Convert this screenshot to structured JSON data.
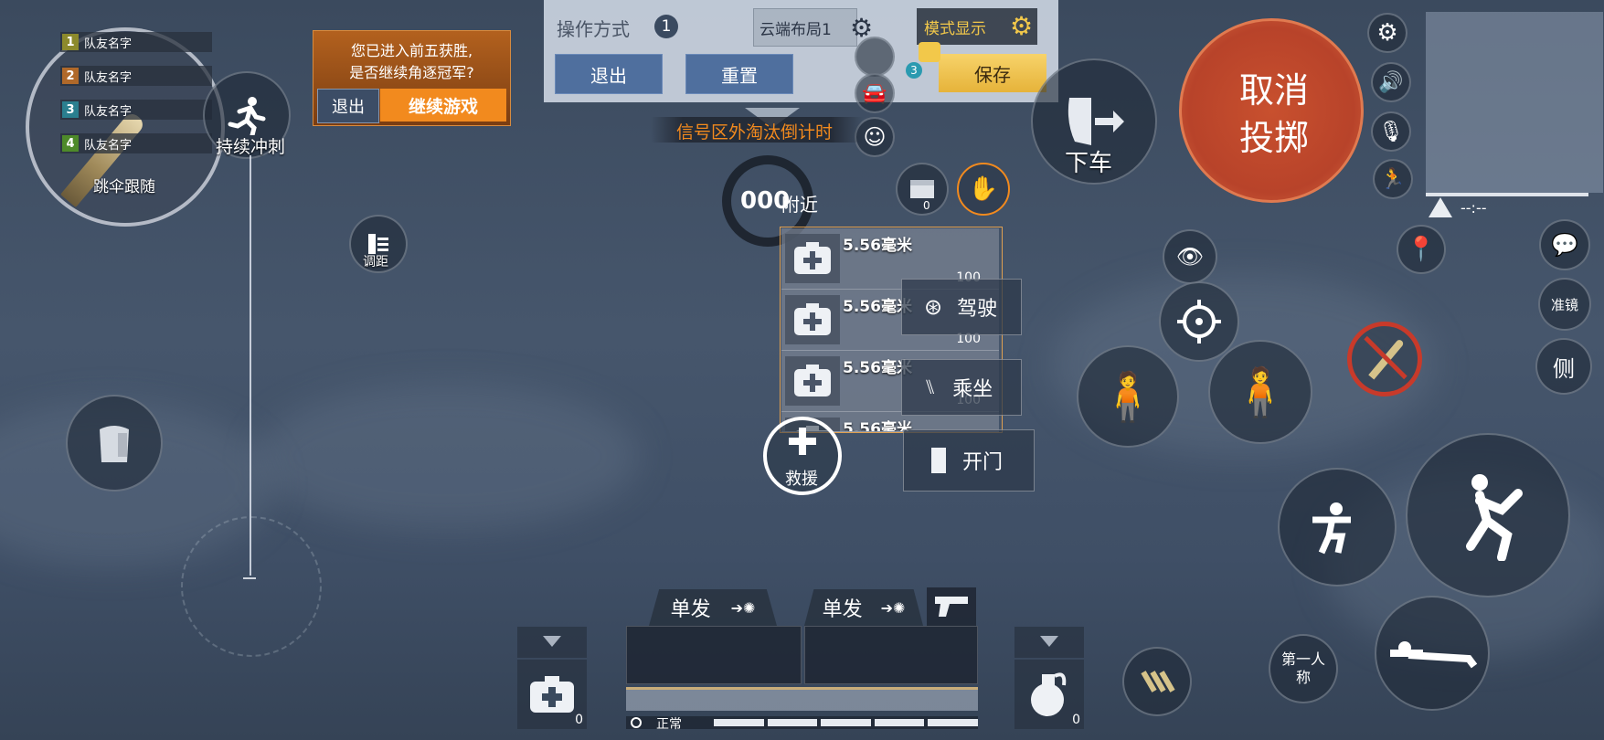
{
  "team": {
    "members": [
      {
        "num": "1",
        "name": "队友名字",
        "color": "#8c8a2c"
      },
      {
        "num": "2",
        "name": "队友名字",
        "color": "#b0692a"
      },
      {
        "num": "3",
        "name": "队友名字",
        "color": "#2a7f8f"
      },
      {
        "num": "4",
        "name": "队友名字",
        "color": "#4e8a2a"
      }
    ],
    "follow_label": "跳伞跟随"
  },
  "sprint_label": "持续冲刺",
  "range_label": "调距",
  "win_prompt": {
    "line1": "您已进入前五获胜,",
    "line2": "是否继续角逐冠军?",
    "exit_label": "退出",
    "continue_label": "继续游戏"
  },
  "layout_panel": {
    "title": "操作方式",
    "info": "1",
    "cloud_label": "云端布局1",
    "mode_label": "模式显示",
    "exit_label": "退出",
    "reset_label": "重置",
    "save_label": "保存",
    "badge": "3"
  },
  "signal_text": "信号区外淘汰倒计时",
  "nearby": {
    "timer": "000",
    "label": "附近"
  },
  "box_count": "0",
  "items": [
    {
      "name": "5.56毫米",
      "qty": "100"
    },
    {
      "name": "5.56毫米",
      "qty": "100"
    },
    {
      "name": "5.56毫米",
      "qty": "100"
    },
    {
      "name": "5.56毫米",
      "qty": ""
    }
  ],
  "actions": {
    "drive": "驾驶",
    "ride": "乘坐",
    "door": "开门",
    "rescue": "救援",
    "exit_vehicle": "下车",
    "cancel_throw": "取消投掷"
  },
  "minimap": {
    "status": "--:--"
  },
  "scope_label": "准镜",
  "side_label": "侧",
  "perspective_label": "第一人称",
  "weapons": [
    {
      "mode": "单发"
    },
    {
      "mode": "单发"
    }
  ],
  "medkit_count": "0",
  "grenade_count": "0",
  "status_text": "正常",
  "colors": {
    "orange": "#f28a1e",
    "red": "#c84a2e",
    "yellow": "#f2c84a",
    "blue": "#4f6f9e"
  }
}
